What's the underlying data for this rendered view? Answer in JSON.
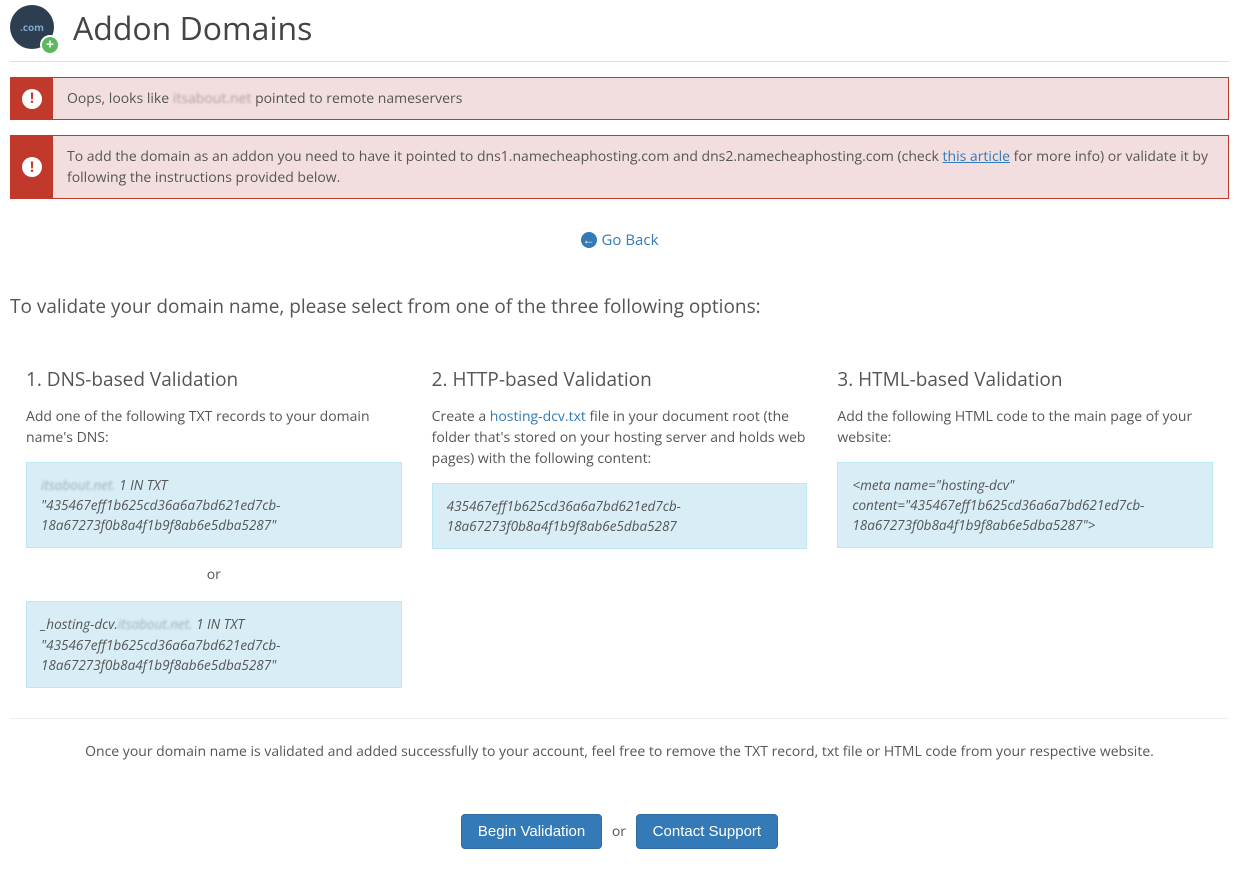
{
  "page_title": "Addon Domains",
  "icon_text": ".com",
  "alert1": {
    "prefix": "Oops, looks like ",
    "domain_blur": "itsabout.net",
    "suffix": " pointed to remote nameservers"
  },
  "alert2": {
    "prefix": "To add the domain as an addon you need to have it pointed to dns1.namecheaphosting.com and dns2.namecheaphosting.com (check ",
    "link_text": "this article",
    "suffix": " for more info) or validate it by following the instructions provided below."
  },
  "go_back": "Go Back",
  "intro": "To validate your domain name, please select from one of the three following options:",
  "opt1": {
    "title": "1. DNS-based Validation",
    "desc": "Add one of the following TXT records to your domain name's DNS:",
    "code1_blur": "itsabout.net.",
    "code1_rest": " 1 IN TXT \"435467eff1b625cd36a6a7bd621ed7cb-18a67273f0b8a4f1b9f8ab6e5dba5287\"",
    "or": "or",
    "code2_prefix": "_hosting-dcv.",
    "code2_blur": "itsabout.net.",
    "code2_rest": " 1 IN TXT \"435467eff1b625cd36a6a7bd621ed7cb-18a67273f0b8a4f1b9f8ab6e5dba5287\""
  },
  "opt2": {
    "title": "2. HTTP-based Validation",
    "desc_prefix": "Create a ",
    "desc_link": "hosting-dcv.txt",
    "desc_suffix": " file in your document root (the folder that's stored on your hosting server and holds web pages) with the following content:",
    "code": "435467eff1b625cd36a6a7bd621ed7cb-18a67273f0b8a4f1b9f8ab6e5dba5287"
  },
  "opt3": {
    "title": "3. HTML-based Validation",
    "desc": "Add the following HTML code to the main page of your website:",
    "code": " <meta  name=\"hosting-dcv\" content=\"435467eff1b625cd36a6a7bd621ed7cb-18a67273f0b8a4f1b9f8ab6e5dba5287\">"
  },
  "note": "Once your domain name is validated and added successfully to your account, feel free to remove the TXT record, txt file or HTML code from your respective website.",
  "actions": {
    "begin": "Begin Validation",
    "or": "or",
    "support": "Contact Support"
  }
}
